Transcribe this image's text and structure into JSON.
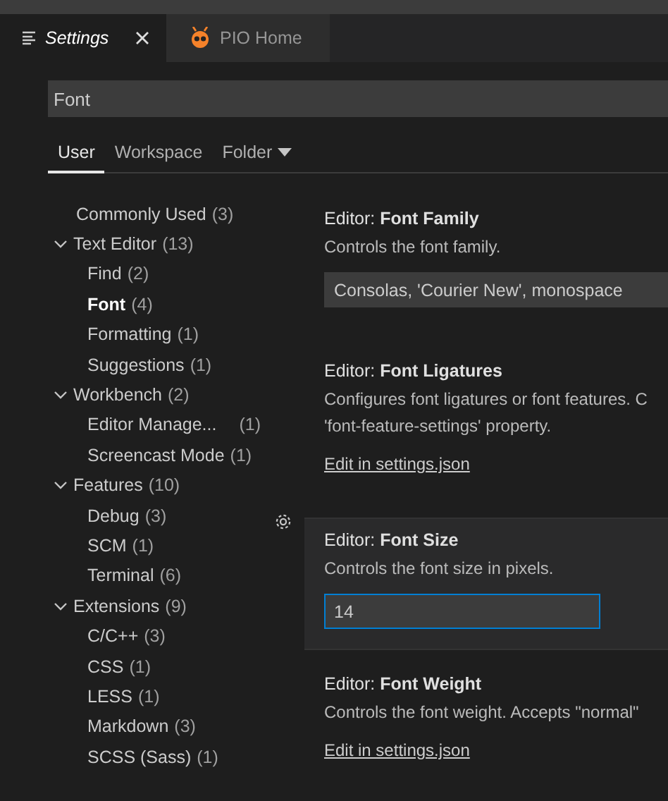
{
  "tabs": [
    {
      "label": "Settings",
      "selected": true
    },
    {
      "label": "PIO Home",
      "selected": false
    }
  ],
  "search": {
    "value": "Font"
  },
  "scopes": [
    {
      "label": "User",
      "selected": true,
      "dropdown": false
    },
    {
      "label": "Workspace",
      "selected": false,
      "dropdown": false
    },
    {
      "label": "Folder",
      "selected": false,
      "dropdown": true
    }
  ],
  "tree": [
    {
      "label": "Commonly Used",
      "count": "(3)",
      "selected": false
    },
    {
      "label": "Text Editor",
      "count": "(13)",
      "expanded": true,
      "selected": false,
      "children": [
        {
          "label": "Find",
          "count": "(2)",
          "selected": false
        },
        {
          "label": "Font",
          "count": "(4)",
          "selected": true
        },
        {
          "label": "Formatting",
          "count": "(1)",
          "selected": false
        },
        {
          "label": "Suggestions",
          "count": "(1)",
          "selected": false
        }
      ]
    },
    {
      "label": "Workbench",
      "count": "(2)",
      "expanded": true,
      "selected": false,
      "children": [
        {
          "label": "Editor Manage...",
          "count": "(1)",
          "selected": false
        },
        {
          "label": "Screencast Mode",
          "count": "(1)",
          "selected": false
        }
      ]
    },
    {
      "label": "Features",
      "count": "(10)",
      "expanded": true,
      "selected": false,
      "children": [
        {
          "label": "Debug",
          "count": "(3)",
          "selected": false
        },
        {
          "label": "SCM",
          "count": "(1)",
          "selected": false
        },
        {
          "label": "Terminal",
          "count": "(6)",
          "selected": false
        }
      ]
    },
    {
      "label": "Extensions",
      "count": "(9)",
      "expanded": true,
      "selected": false,
      "children": [
        {
          "label": "C/C++",
          "count": "(3)",
          "selected": false
        },
        {
          "label": "CSS",
          "count": "(1)",
          "selected": false
        },
        {
          "label": "LESS",
          "count": "(1)",
          "selected": false
        },
        {
          "label": "Markdown",
          "count": "(3)",
          "selected": false
        },
        {
          "label": "SCSS (Sass)",
          "count": "(1)",
          "selected": false
        }
      ]
    }
  ],
  "settings": [
    {
      "category": "Editor:",
      "name": "Font Family",
      "description": "Controls the font family.",
      "kind": "input",
      "value": "Consolas, 'Courier New', monospace",
      "focused": false
    },
    {
      "category": "Editor:",
      "name": "Font Ligatures",
      "description": "Configures font ligatures or font features. C\n'font-feature-settings' property.",
      "kind": "link",
      "link": "Edit in settings.json",
      "focused": false
    },
    {
      "category": "Editor:",
      "name": "Font Size",
      "description": "Controls the font size in pixels.",
      "kind": "input",
      "value": "14",
      "focused": true
    },
    {
      "category": "Editor:",
      "name": "Font Weight",
      "description": "Controls the font weight. Accepts \"normal\"",
      "kind": "link",
      "link": "Edit in settings.json",
      "focused": false
    }
  ]
}
